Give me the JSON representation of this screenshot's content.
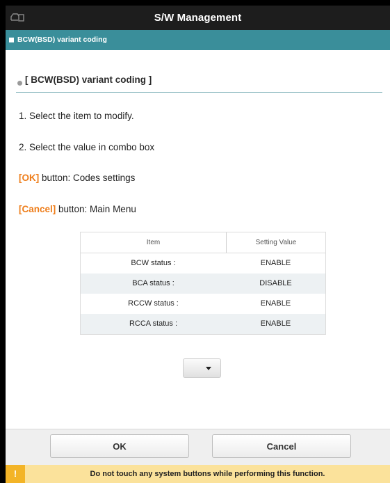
{
  "titlebar": {
    "title": "S/W Management",
    "icon": "vehicle-info-icon"
  },
  "section": {
    "label": "BCW(BSD) variant coding"
  },
  "content": {
    "heading": "[ BCW(BSD) variant coding ]",
    "instructions": [
      "1. Select the item to modify.",
      "2. Select the value in combo box"
    ],
    "ok_hint": {
      "key": "[OK]",
      "text": " button: Codes settings"
    },
    "cancel_hint": {
      "key": "[Cancel]",
      "text": " button: Main Menu"
    }
  },
  "table": {
    "columns": [
      "Item",
      "Setting Value"
    ],
    "rows": [
      {
        "item": "BCW status :",
        "value": "ENABLE"
      },
      {
        "item": "BCA status :",
        "value": "DISABLE"
      },
      {
        "item": "RCCW status :",
        "value": "ENABLE"
      },
      {
        "item": "RCCA status :",
        "value": "ENABLE"
      }
    ]
  },
  "combo": {
    "selected": ""
  },
  "footer": {
    "ok_label": "OK",
    "cancel_label": "Cancel"
  },
  "warning": {
    "icon_glyph": "!",
    "message": "Do not touch any system buttons while performing this function."
  },
  "colors": {
    "titlebar": "#1d1d1d",
    "section": "#3a8e9a",
    "highlight": "#ee7d1a",
    "warning_bg": "#fbe29b",
    "warning_icon": "#f3b427"
  }
}
